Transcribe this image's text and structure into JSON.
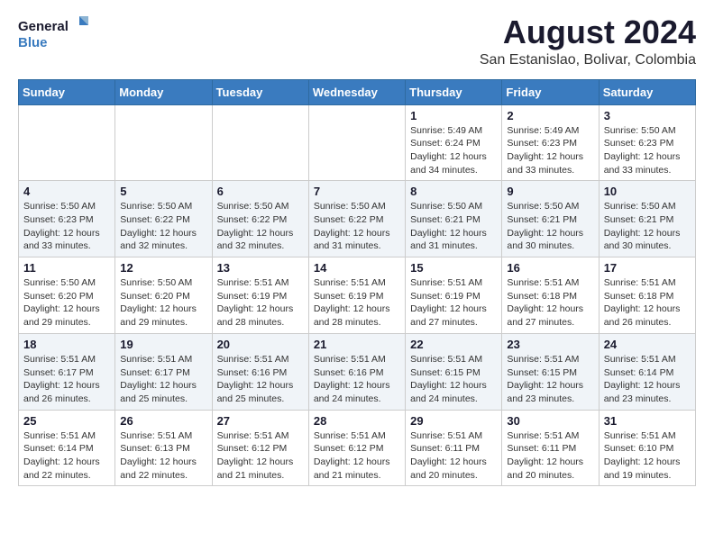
{
  "logo": {
    "line1": "General",
    "line2": "Blue"
  },
  "title": "August 2024",
  "subtitle": "San Estanislao, Bolivar, Colombia",
  "days_of_week": [
    "Sunday",
    "Monday",
    "Tuesday",
    "Wednesday",
    "Thursday",
    "Friday",
    "Saturday"
  ],
  "weeks": [
    [
      {
        "day": "",
        "info": ""
      },
      {
        "day": "",
        "info": ""
      },
      {
        "day": "",
        "info": ""
      },
      {
        "day": "",
        "info": ""
      },
      {
        "day": "1",
        "info": "Sunrise: 5:49 AM\nSunset: 6:24 PM\nDaylight: 12 hours\nand 34 minutes."
      },
      {
        "day": "2",
        "info": "Sunrise: 5:49 AM\nSunset: 6:23 PM\nDaylight: 12 hours\nand 33 minutes."
      },
      {
        "day": "3",
        "info": "Sunrise: 5:50 AM\nSunset: 6:23 PM\nDaylight: 12 hours\nand 33 minutes."
      }
    ],
    [
      {
        "day": "4",
        "info": "Sunrise: 5:50 AM\nSunset: 6:23 PM\nDaylight: 12 hours\nand 33 minutes."
      },
      {
        "day": "5",
        "info": "Sunrise: 5:50 AM\nSunset: 6:22 PM\nDaylight: 12 hours\nand 32 minutes."
      },
      {
        "day": "6",
        "info": "Sunrise: 5:50 AM\nSunset: 6:22 PM\nDaylight: 12 hours\nand 32 minutes."
      },
      {
        "day": "7",
        "info": "Sunrise: 5:50 AM\nSunset: 6:22 PM\nDaylight: 12 hours\nand 31 minutes."
      },
      {
        "day": "8",
        "info": "Sunrise: 5:50 AM\nSunset: 6:21 PM\nDaylight: 12 hours\nand 31 minutes."
      },
      {
        "day": "9",
        "info": "Sunrise: 5:50 AM\nSunset: 6:21 PM\nDaylight: 12 hours\nand 30 minutes."
      },
      {
        "day": "10",
        "info": "Sunrise: 5:50 AM\nSunset: 6:21 PM\nDaylight: 12 hours\nand 30 minutes."
      }
    ],
    [
      {
        "day": "11",
        "info": "Sunrise: 5:50 AM\nSunset: 6:20 PM\nDaylight: 12 hours\nand 29 minutes."
      },
      {
        "day": "12",
        "info": "Sunrise: 5:50 AM\nSunset: 6:20 PM\nDaylight: 12 hours\nand 29 minutes."
      },
      {
        "day": "13",
        "info": "Sunrise: 5:51 AM\nSunset: 6:19 PM\nDaylight: 12 hours\nand 28 minutes."
      },
      {
        "day": "14",
        "info": "Sunrise: 5:51 AM\nSunset: 6:19 PM\nDaylight: 12 hours\nand 28 minutes."
      },
      {
        "day": "15",
        "info": "Sunrise: 5:51 AM\nSunset: 6:19 PM\nDaylight: 12 hours\nand 27 minutes."
      },
      {
        "day": "16",
        "info": "Sunrise: 5:51 AM\nSunset: 6:18 PM\nDaylight: 12 hours\nand 27 minutes."
      },
      {
        "day": "17",
        "info": "Sunrise: 5:51 AM\nSunset: 6:18 PM\nDaylight: 12 hours\nand 26 minutes."
      }
    ],
    [
      {
        "day": "18",
        "info": "Sunrise: 5:51 AM\nSunset: 6:17 PM\nDaylight: 12 hours\nand 26 minutes."
      },
      {
        "day": "19",
        "info": "Sunrise: 5:51 AM\nSunset: 6:17 PM\nDaylight: 12 hours\nand 25 minutes."
      },
      {
        "day": "20",
        "info": "Sunrise: 5:51 AM\nSunset: 6:16 PM\nDaylight: 12 hours\nand 25 minutes."
      },
      {
        "day": "21",
        "info": "Sunrise: 5:51 AM\nSunset: 6:16 PM\nDaylight: 12 hours\nand 24 minutes."
      },
      {
        "day": "22",
        "info": "Sunrise: 5:51 AM\nSunset: 6:15 PM\nDaylight: 12 hours\nand 24 minutes."
      },
      {
        "day": "23",
        "info": "Sunrise: 5:51 AM\nSunset: 6:15 PM\nDaylight: 12 hours\nand 23 minutes."
      },
      {
        "day": "24",
        "info": "Sunrise: 5:51 AM\nSunset: 6:14 PM\nDaylight: 12 hours\nand 23 minutes."
      }
    ],
    [
      {
        "day": "25",
        "info": "Sunrise: 5:51 AM\nSunset: 6:14 PM\nDaylight: 12 hours\nand 22 minutes."
      },
      {
        "day": "26",
        "info": "Sunrise: 5:51 AM\nSunset: 6:13 PM\nDaylight: 12 hours\nand 22 minutes."
      },
      {
        "day": "27",
        "info": "Sunrise: 5:51 AM\nSunset: 6:12 PM\nDaylight: 12 hours\nand 21 minutes."
      },
      {
        "day": "28",
        "info": "Sunrise: 5:51 AM\nSunset: 6:12 PM\nDaylight: 12 hours\nand 21 minutes."
      },
      {
        "day": "29",
        "info": "Sunrise: 5:51 AM\nSunset: 6:11 PM\nDaylight: 12 hours\nand 20 minutes."
      },
      {
        "day": "30",
        "info": "Sunrise: 5:51 AM\nSunset: 6:11 PM\nDaylight: 12 hours\nand 20 minutes."
      },
      {
        "day": "31",
        "info": "Sunrise: 5:51 AM\nSunset: 6:10 PM\nDaylight: 12 hours\nand 19 minutes."
      }
    ]
  ]
}
